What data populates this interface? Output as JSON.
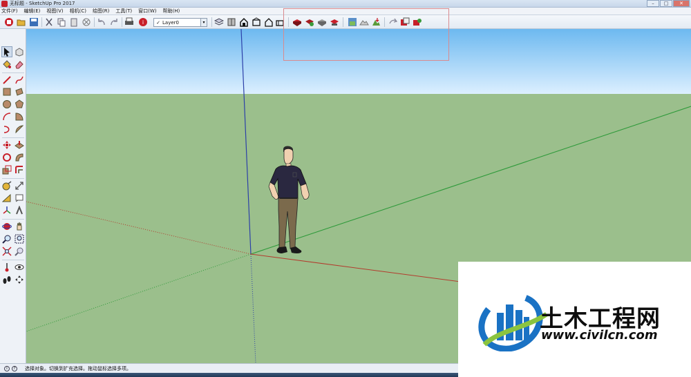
{
  "window": {
    "title": "无标题 - SketchUp Pro 2017",
    "controls": {
      "minimize": "–",
      "maximize": "□",
      "close": "✕"
    }
  },
  "menubar": {
    "items": [
      "文件(F)",
      "编辑(E)",
      "视图(V)",
      "相机(C)",
      "绘图(R)",
      "工具(T)",
      "窗口(W)",
      "帮助(H)"
    ]
  },
  "toolbar": {
    "layer_select": {
      "check": "✓",
      "value": "Layer0",
      "arrow": "▾"
    },
    "buttons": [
      "new-icon",
      "open-icon",
      "save-icon",
      "cut-icon",
      "copy-icon",
      "paste-icon",
      "erase-icon",
      "undo-icon",
      "redo-icon",
      "print-icon",
      "model-info-icon",
      "layers-icon",
      "components-icon",
      "iso-view-icon",
      "top-view-icon",
      "front-view-icon",
      "right-view-icon",
      "3d-warehouse-icon",
      "extension-warehouse-icon",
      "share-model-icon",
      "upload-icon",
      "add-location-icon",
      "toggle-terrain-icon",
      "photo-texture-icon",
      "sandbox-icon",
      "section-plane-icon",
      "section-display-icon"
    ]
  },
  "palette": {
    "tools": [
      "select-icon",
      "make-component-icon",
      "paint-bucket-icon",
      "eraser-icon",
      "line-icon",
      "freehand-icon",
      "rectangle-icon",
      "rotated-rectangle-icon",
      "circle-icon",
      "polygon-icon",
      "arc-icon",
      "pie-icon",
      "two-point-arc-icon",
      "three-point-arc-icon",
      "move-icon",
      "push-pull-icon",
      "rotate-icon",
      "follow-me-icon",
      "scale-icon",
      "offset-icon",
      "tape-measure-icon",
      "dimension-icon",
      "protractor-icon",
      "text-icon",
      "axes-icon",
      "3d-text-icon",
      "orbit-icon",
      "pan-icon",
      "zoom-icon",
      "zoom-window-icon",
      "zoom-extents-icon",
      "previous-icon",
      "position-camera-icon",
      "look-around-icon",
      "walk-icon",
      "section-icon"
    ]
  },
  "status": {
    "icon1": "i",
    "icon2": "?",
    "text": "选择对象。切换到扩充选择。拖动鼠标选择多项。"
  },
  "colors": {
    "sky_top": "#6db9f0",
    "sky_bottom": "#dcefff",
    "ground": "#9bbf8c",
    "axis_red": "#b33a2c",
    "axis_green": "#2e9a3a",
    "axis_blue": "#2b3fa8",
    "highlight": "#d98a8e"
  },
  "watermark": {
    "cn": "土木工程网",
    "url": "www.civilcn.com"
  }
}
